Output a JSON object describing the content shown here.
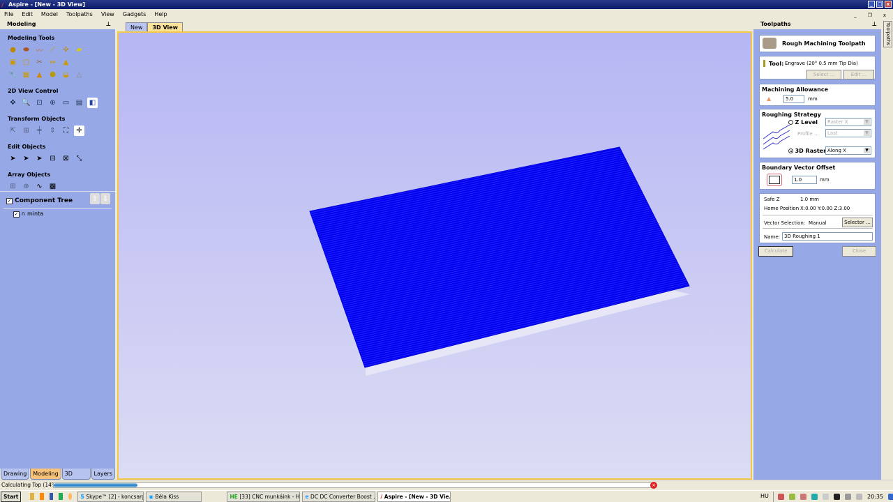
{
  "window": {
    "title": "Aspire - [New - 3D View]"
  },
  "menu": [
    "File",
    "Edit",
    "Model",
    "Toolpaths",
    "View",
    "Gadgets",
    "Help"
  ],
  "left_panel": {
    "title": "Modeling",
    "sections": [
      "Modeling Tools",
      "2D View Control",
      "Transform Objects",
      "Edit Objects",
      "Array Objects"
    ],
    "component_tree": {
      "title": "Component Tree",
      "checked": true,
      "items": [
        {
          "label": "minta",
          "checked": true
        }
      ]
    },
    "tabs": [
      "Drawing",
      "Modeling",
      "3D Clipart",
      "Layers"
    ],
    "active_tab": "Modeling"
  },
  "view_tabs": [
    "New",
    "3D View"
  ],
  "active_view_tab": "3D View",
  "view": {
    "mesh_color": "#0000ee"
  },
  "toolpaths": {
    "panel_title": "Toolpaths",
    "side_tab": "Toolpaths",
    "header": "Rough Machining Toolpath",
    "tool_label": "Tool:",
    "tool_value": "Engrave (20° 0.5 mm Tip Dia)",
    "select_button": "Select ...",
    "edit_button": "Edit ...",
    "allowance_title": "Machining Allowance",
    "allowance_value": "5.0",
    "allowance_unit": "mm",
    "strategy_title": "Roughing Strategy",
    "z_level_label": "Z Level",
    "z_level_select": "Raster X",
    "profile_label": "Profile ...",
    "profile_select": "Last",
    "raster_label": "3D Raster",
    "raster_select": "Along X",
    "strategy_selected": "3D Raster",
    "boundary_title": "Boundary Vector Offset",
    "boundary_value": "1.0",
    "boundary_unit": "mm",
    "safe_z_label": "Safe Z",
    "safe_z_value": "1.0 mm",
    "home_label": "Home Position",
    "home_value": "X:0.00 Y:0.00 Z:3.00",
    "vector_sel_label": "Vector Selection:",
    "vector_sel_value": "Manual",
    "selector_button": "Selector ...",
    "name_label": "Name:",
    "name_value": "3D Roughing 1",
    "calculate_button": "Calculate",
    "close_button": "Close"
  },
  "status": {
    "text": "Calculating Top (14%)",
    "progress_percent": 14
  },
  "taskbar": {
    "start": "Start",
    "tasks": [
      "Skype™ [2] - koncsargy...",
      "Béla Kiss",
      "[33] CNC munkáink - Hob...",
      "DC DC Converter Boost ...",
      "Aspire - [New - 3D Vie..."
    ],
    "active_task": "Aspire - [New - 3D Vie...",
    "lang": "HU",
    "clock": "20:35"
  }
}
